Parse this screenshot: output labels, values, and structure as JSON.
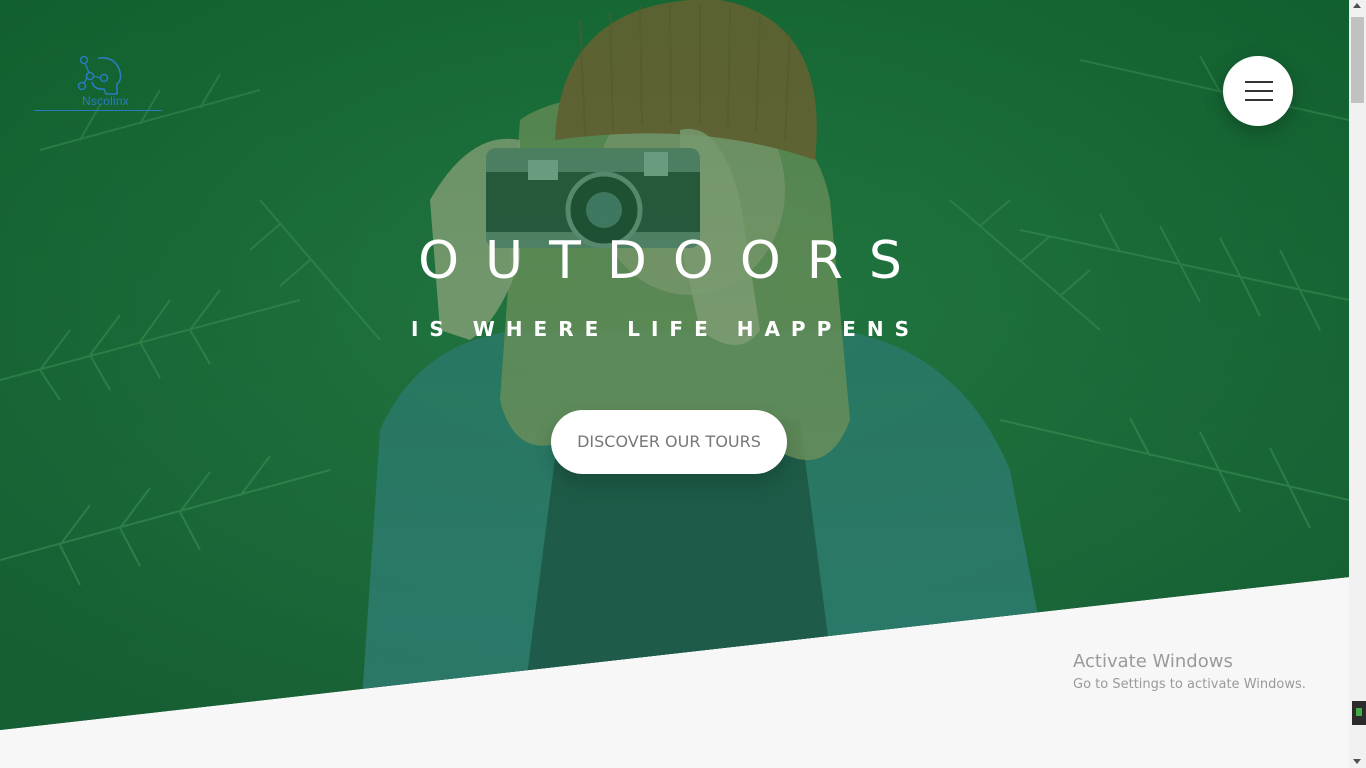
{
  "brand": {
    "name": "Nscolinx"
  },
  "hero": {
    "title": "OUTDOORS",
    "subtitle": "IS WHERE LIFE HAPPENS",
    "cta_label": "DISCOVER OUR TOURS",
    "overlay_color": "#1a8a4a"
  },
  "nav": {
    "menu_icon": "hamburger-icon"
  },
  "watermark": {
    "line1": "Activate Windows",
    "line2": "Go to Settings to activate Windows."
  }
}
